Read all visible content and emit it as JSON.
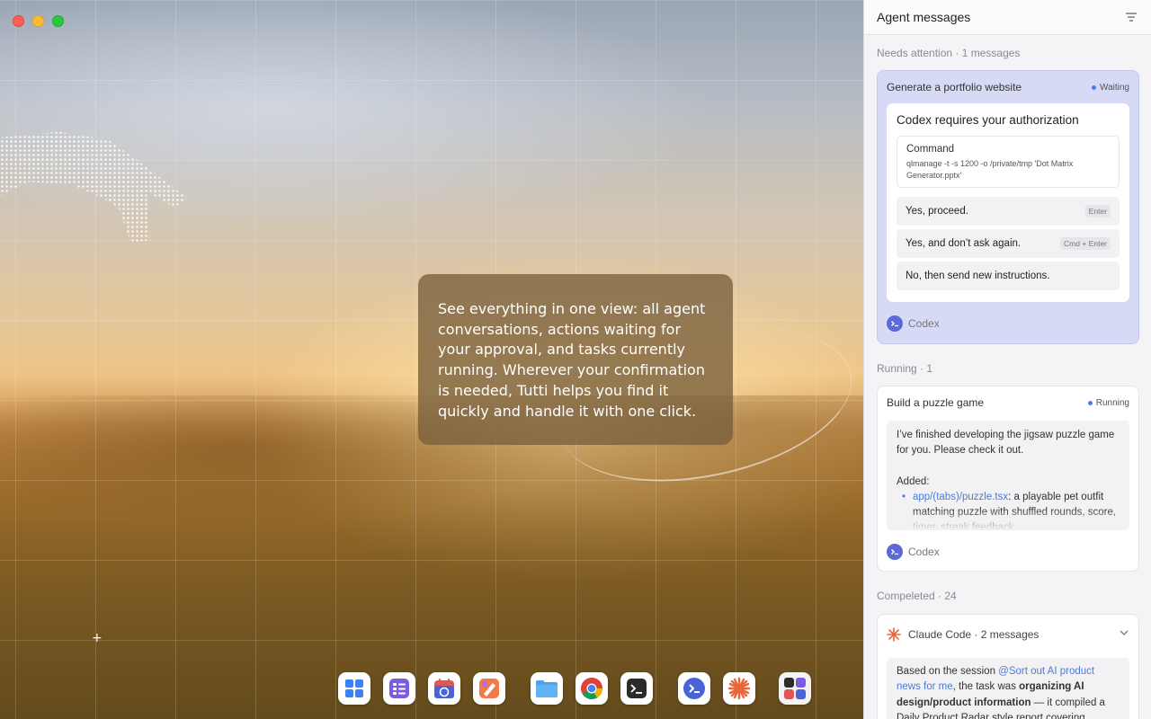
{
  "desktop": {
    "intro_text": "See everything in one view: all agent conversations, actions waiting for your approval, and tasks currently running. Wherever your confirmation is needed, Tutti helps you find it quickly and handle it with one click.",
    "dock": [
      {
        "name": "launchpad-icon",
        "color": "#3b82f6"
      },
      {
        "name": "checklist-icon",
        "color": "#7c5ce0"
      },
      {
        "name": "calendar-sync-icon",
        "color": "#e25555"
      },
      {
        "name": "design-tool-icon",
        "color": "#e8663a"
      },
      {
        "name": "folder-icon",
        "color": "#4aa3f0"
      },
      {
        "name": "chrome-icon",
        "color": "#4285f4"
      },
      {
        "name": "terminal-icon",
        "color": "#2b2b2b"
      },
      {
        "name": "codex-icon",
        "color": "#4a63d8"
      },
      {
        "name": "claude-icon",
        "color": "#e8663a"
      },
      {
        "name": "apps-grid-icon",
        "color": "#444444"
      }
    ]
  },
  "panel": {
    "title": "Agent messages",
    "needs_attention": {
      "label": "Needs attention · 1 messages",
      "card": {
        "title": "Generate a portfolio website",
        "status": "Waiting",
        "auth_title": "Codex requires your authorization",
        "command_label": "Command",
        "command_text": "qlmanage -t -s 1200 -o /private/tmp 'Dot Matrix Generator.pptx'",
        "options": [
          {
            "label": "Yes, proceed.",
            "shortcut": "Enter"
          },
          {
            "label": "Yes, and don’t ask again.",
            "shortcut": "Cmd + Enter"
          },
          {
            "label": "No, then send new instructions.",
            "shortcut": ""
          }
        ],
        "agent": "Codex"
      }
    },
    "running": {
      "label": "Running · 1",
      "card": {
        "title": "Build a puzzle game",
        "status": "Running",
        "message_intro": "I’ve finished developing the jigsaw puzzle game for you. Please check it out.",
        "added_label": "Added:",
        "file_link": "app/(tabs)/puzzle.tsx",
        "file_desc": ": a playable pet outfit matching puzzle with shuffled rounds, score, timer, streak feedback",
        "agent": "Codex"
      }
    },
    "completed": {
      "label": "Compeleted · 24",
      "card": {
        "header": "Claude Code · 2 messages",
        "text_1": "Based on the session ",
        "link": "@Sort out AI product news for me",
        "text_2": ", the task was ",
        "bold_1": "organizing AI design/product information",
        "text_3": " — it compiled a Daily Product Radar style report covering"
      }
    }
  }
}
